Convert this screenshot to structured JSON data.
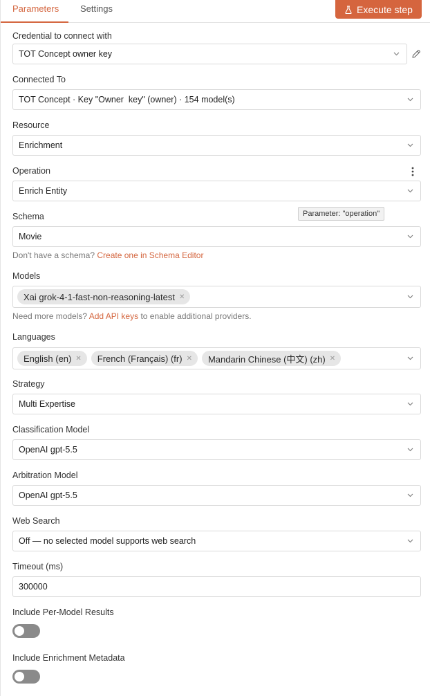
{
  "tabs": {
    "parameters": "Parameters",
    "settings": "Settings"
  },
  "execute_button": "Execute step",
  "credential": {
    "label": "Credential to connect with",
    "value": "TOT Concept owner key"
  },
  "connected_to": {
    "label": "Connected To",
    "value": "TOT Concept · Key \"Owner  key\" (owner) · 154 model(s)"
  },
  "resource": {
    "label": "Resource",
    "value": "Enrichment"
  },
  "operation": {
    "label": "Operation",
    "value": "Enrich Entity",
    "tooltip": "Parameter: \"operation\""
  },
  "schema": {
    "label": "Schema",
    "value": "Movie",
    "hint_prefix": "Don't have a schema?",
    "hint_link": "Create one in Schema Editor"
  },
  "models": {
    "label": "Models",
    "chips": [
      "Xai grok-4-1-fast-non-reasoning-latest"
    ],
    "hint_prefix": "Need more models?",
    "hint_link": "Add API keys",
    "hint_suffix": "to enable additional providers."
  },
  "languages": {
    "label": "Languages",
    "chips": [
      "English (en)",
      "French (Français) (fr)",
      "Mandarin Chinese (中文) (zh)"
    ]
  },
  "strategy": {
    "label": "Strategy",
    "value": "Multi Expertise"
  },
  "classification_model": {
    "label": "Classification Model",
    "value": "OpenAI gpt-5.5"
  },
  "arbitration_model": {
    "label": "Arbitration Model",
    "value": "OpenAI gpt-5.5"
  },
  "web_search": {
    "label": "Web Search",
    "value": "Off — no selected model supports web search"
  },
  "timeout": {
    "label": "Timeout (ms)",
    "value": "300000"
  },
  "per_model_results": {
    "label": "Include Per-Model Results",
    "on": false
  },
  "enrichment_metadata": {
    "label": "Include Enrichment Metadata",
    "on": false
  },
  "colors": {
    "accent": "#d5653e",
    "toggle_off": "#8a8a8a"
  },
  "icons": {
    "execute": "flask-icon",
    "edit": "pencil-icon",
    "more": "kebab-icon",
    "dropdown": "chevron-down-icon",
    "remove": "close-icon"
  }
}
